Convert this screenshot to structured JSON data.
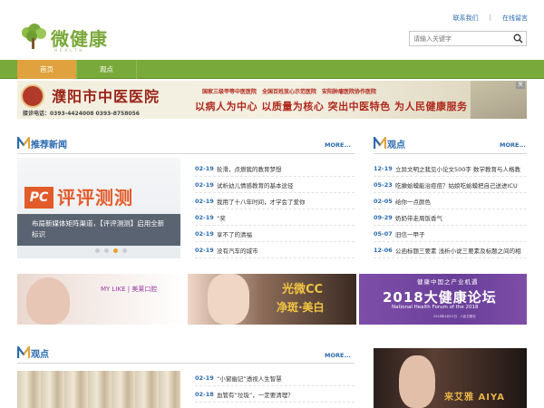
{
  "header": {
    "logo_text": "微健康",
    "logo_sub": "HEALTH",
    "links": [
      "联系我们",
      "在线留言"
    ],
    "search_placeholder": "请输入关键字"
  },
  "nav": {
    "items": [
      "首页",
      "观点"
    ],
    "active_index": 0
  },
  "banner": {
    "hospital": "濮阳市中医医院",
    "tags": [
      "国家三级甲等中医医院",
      "全国百姓放心示范医院",
      "安阳肿瘤医院协作医院"
    ],
    "phone": "接诊电话：0393-4424008  0393-8758056",
    "slogan": "以病人为中心  以质量为核心  突出中医特色  为人民健康服务",
    "close_label": "关"
  },
  "news": {
    "title": "推荐新闻",
    "more": "MORE...",
    "slide": {
      "logo": "PC",
      "logo_text": "评评测测",
      "caption": "布局新媒体矩阵渠道，【评评测测】启用全新标识",
      "dots": 4,
      "active_dot": 2
    },
    "items": [
      {
        "date": "02-19",
        "text": "轮滑，点燃我的教育梦想"
      },
      {
        "date": "02-19",
        "text": "试析幼儿情感教育的基本途径"
      },
      {
        "date": "02-19",
        "text": "我用了十八年时间，才学会了爱你"
      },
      {
        "date": "02-19",
        "text": "“奖"
      },
      {
        "date": "02-19",
        "text": "享不了的清福"
      },
      {
        "date": "02-19",
        "text": "没有汽车的城市"
      }
    ]
  },
  "views": {
    "title": "观点",
    "more": "MORE...",
    "items": [
      {
        "date": "12-19",
        "text": "立异文明之我见小论文500字 数学教育与人格教"
      },
      {
        "date": "05-23",
        "text": "吃嫩蛤蟆能治痘痘？姑娘吃蛤蟆把自己送进ICU"
      },
      {
        "date": "02-05",
        "text": "给你一点颜色"
      },
      {
        "date": "09-29",
        "text": "奶奶带走周饭香气"
      },
      {
        "date": "05-07",
        "text": "旧信一甲子"
      },
      {
        "date": "12-06",
        "text": "公函标题三要素 浅析小说三要素及标题之间的相"
      }
    ]
  },
  "ads": {
    "ad1_brand": "MY LIKE | 美莱口腔",
    "ad2_line1": "光微CC",
    "ad2_line2": "净斑·美白",
    "ad3_line1": "健康中国之产业机遇",
    "ad3_line2": "2018大健康论坛",
    "ad3_line3": "National Health Forum of the 2018",
    "ad3_line4": "2018年4月21日 · 人民日报社"
  },
  "views2": {
    "title": "观点",
    "more": "MORE...",
    "items": [
      {
        "date": "02-19",
        "text": "“小窗幽记”透视人生智慧"
      },
      {
        "date": "02-18",
        "text": "血管有“垃圾”，一定要清理？"
      }
    ],
    "photo_text": "来艾雅 AIYA"
  },
  "colors": {
    "brand_green": "#79a93a",
    "nav_active": "#e0a23e",
    "link_blue": "#2a6ab0"
  }
}
